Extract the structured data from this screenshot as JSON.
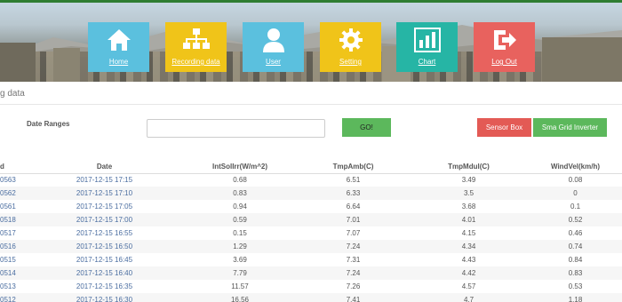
{
  "nav": {
    "tiles": [
      {
        "label": "Home",
        "icon": "home-icon",
        "color": "#5bc0de"
      },
      {
        "label": "Recording data",
        "icon": "sitemap-icon",
        "color": "#f0c419"
      },
      {
        "label": "User",
        "icon": "user-icon",
        "color": "#5bc0de"
      },
      {
        "label": "Setting",
        "icon": "gear-icon",
        "color": "#f0c419"
      },
      {
        "label": "Chart",
        "icon": "bar-chart-icon",
        "color": "#26b5a5"
      },
      {
        "label": "Log Out",
        "icon": "logout-icon",
        "color": "#e8625e"
      }
    ]
  },
  "page": {
    "title": "g data"
  },
  "filter": {
    "date_range_label": "Date Ranges",
    "date_range_value": "",
    "go_label": "GO!",
    "sensor_box_label": "Sensor Box",
    "sma_label": "Sma Grid Inverter"
  },
  "table": {
    "headers": [
      "d",
      "Date",
      "IntSolIrr(W/m^2)",
      "TmpAmb(C)",
      "TmpMdul(C)",
      "WindVel(km/h)"
    ],
    "rows": [
      [
        "0563",
        "2017-12-15 17:15",
        "0.68",
        "6.51",
        "3.49",
        "0.08"
      ],
      [
        "0562",
        "2017-12-15 17:10",
        "0.83",
        "6.33",
        "3.5",
        "0"
      ],
      [
        "0561",
        "2017-12-15 17:05",
        "0.94",
        "6.64",
        "3.68",
        "0.1"
      ],
      [
        "0518",
        "2017-12-15 17:00",
        "0.59",
        "7.01",
        "4.01",
        "0.52"
      ],
      [
        "0517",
        "2017-12-15 16:55",
        "0.15",
        "7.07",
        "4.15",
        "0.46"
      ],
      [
        "0516",
        "2017-12-15 16:50",
        "1.29",
        "7.24",
        "4.34",
        "0.74"
      ],
      [
        "0515",
        "2017-12-15 16:45",
        "3.69",
        "7.31",
        "4.43",
        "0.84"
      ],
      [
        "0514",
        "2017-12-15 16:40",
        "7.79",
        "7.24",
        "4.42",
        "0.83"
      ],
      [
        "0513",
        "2017-12-15 16:35",
        "11.57",
        "7.26",
        "4.57",
        "0.53"
      ],
      [
        "0512",
        "2017-12-15 16:30",
        "16.56",
        "7.41",
        "4.7",
        "1.18"
      ]
    ]
  }
}
